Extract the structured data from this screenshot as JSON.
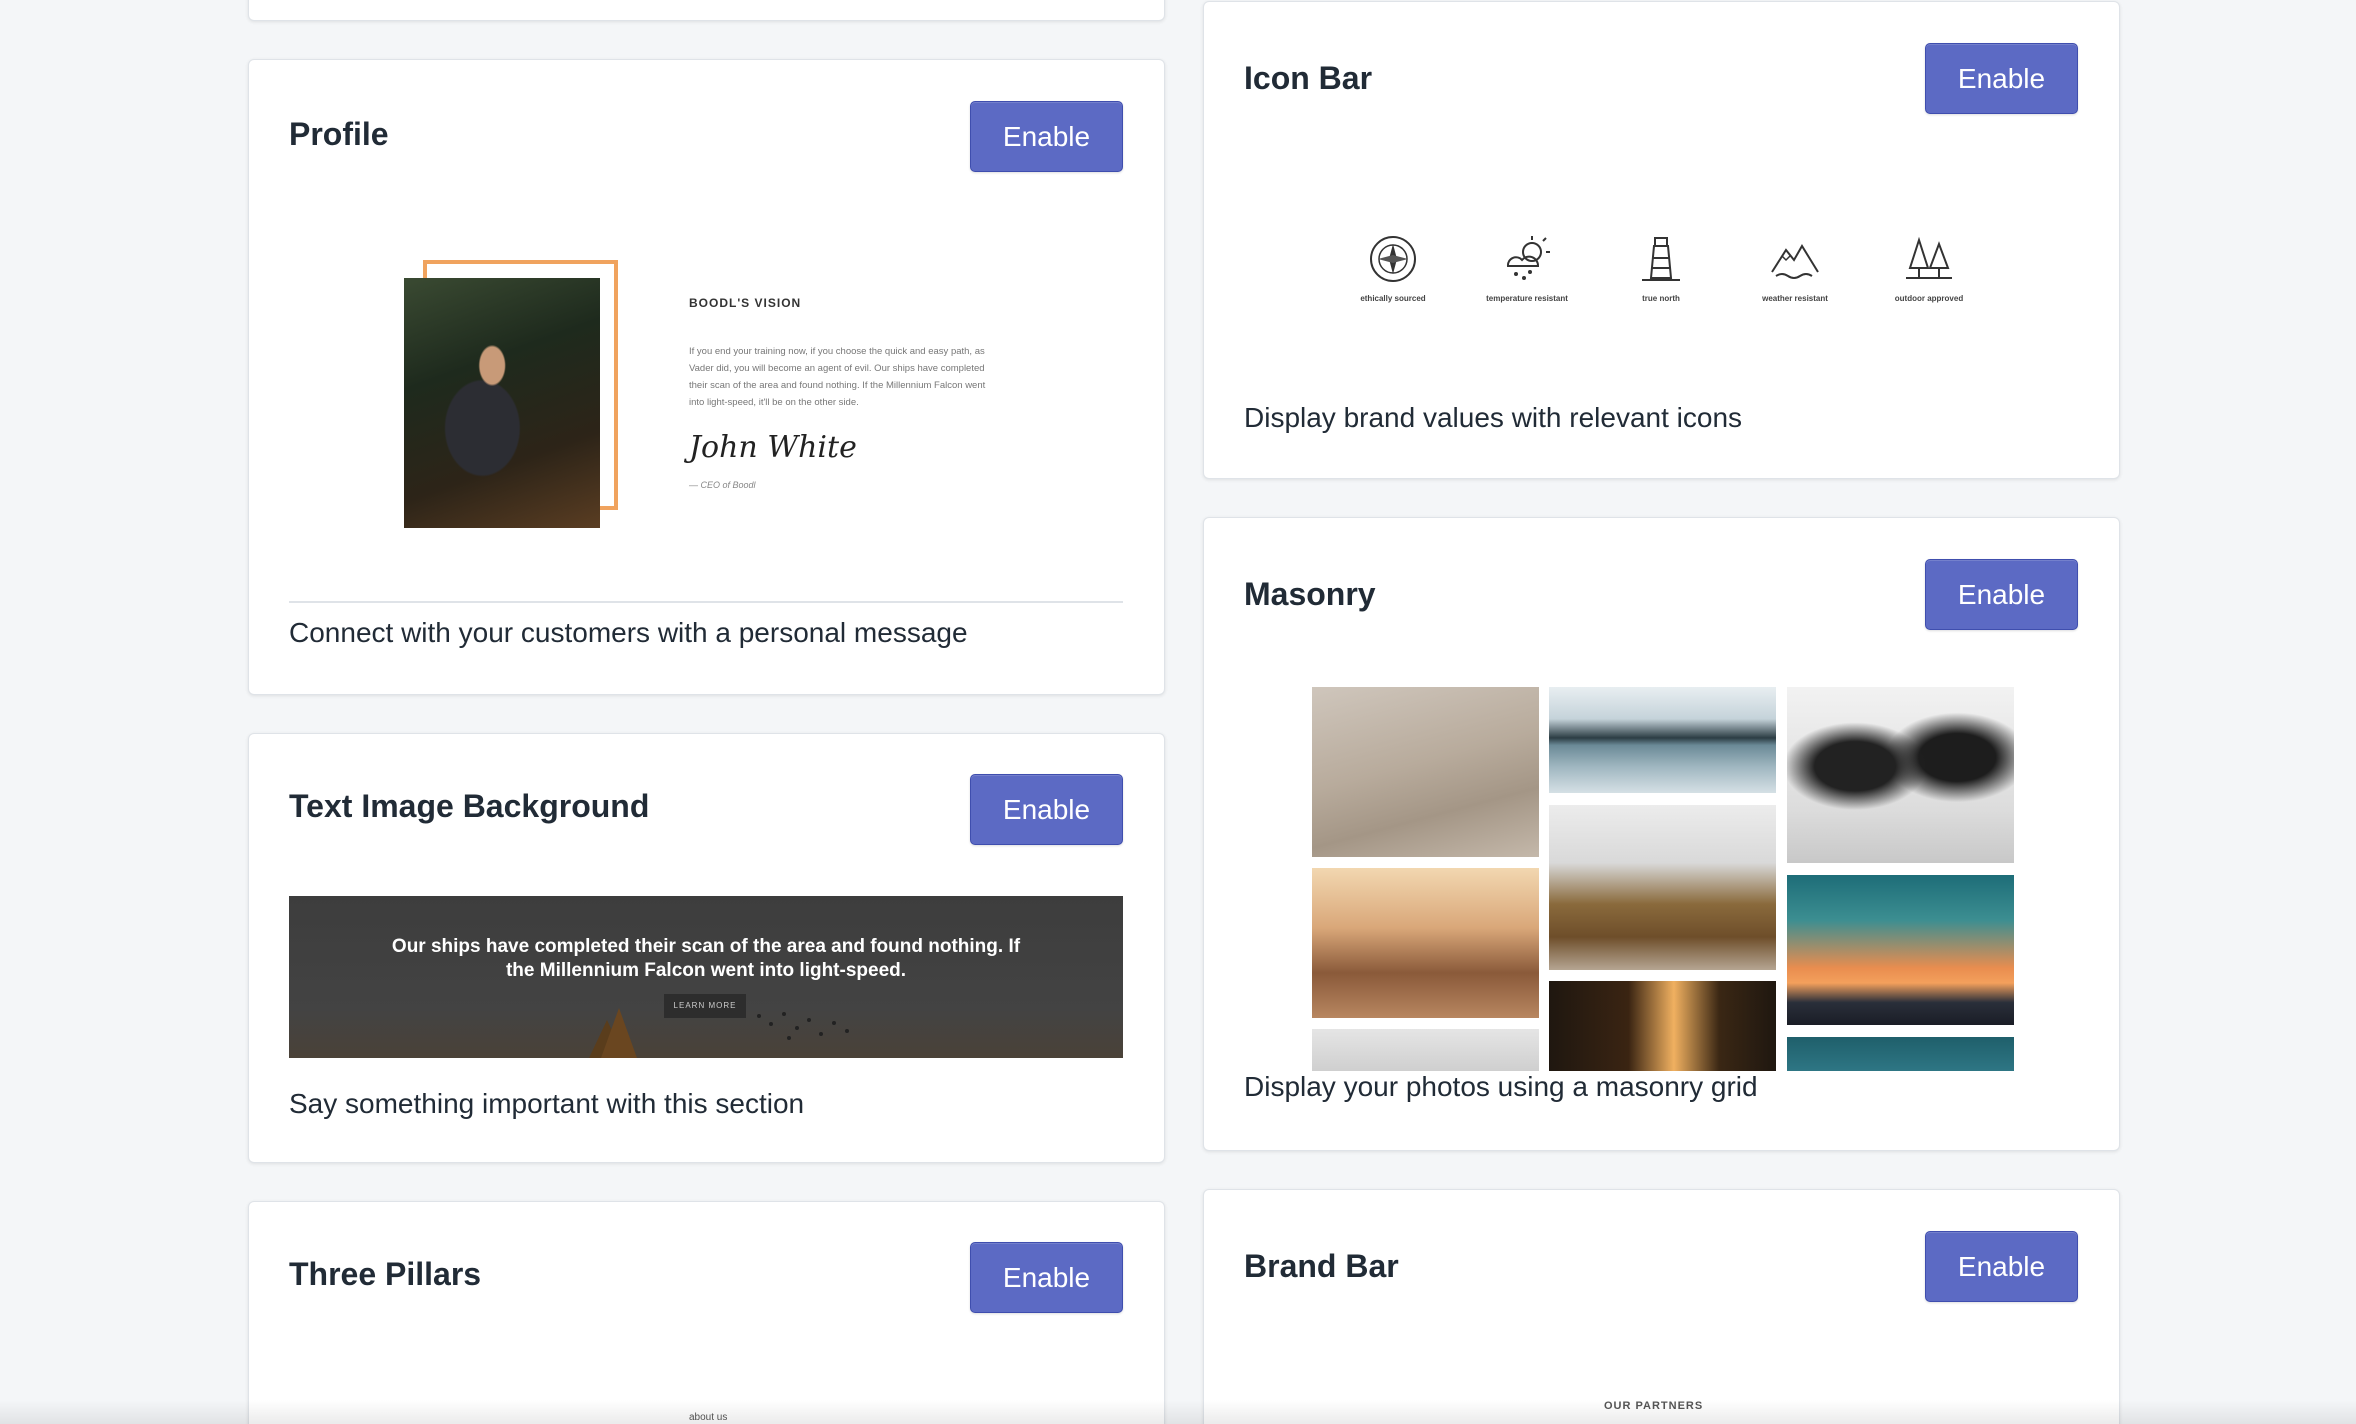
{
  "enable_label": "Enable",
  "accent_color": "#5c6ac4",
  "cards": {
    "profile": {
      "title": "Profile",
      "description": "Connect with your customers with a personal message",
      "preview": {
        "heading": "BOODL'S VISION",
        "body": "If you end your training now, if you choose the quick and easy path, as Vader did, you will become an agent of evil. Our ships have completed their scan of the area and found nothing. If the Millennium Falcon went into light-speed, it'll be on the other side.",
        "signature": "John White",
        "caption": "— CEO of Boodl"
      }
    },
    "text_image_background": {
      "title": "Text Image Background",
      "description": "Say something important with this section",
      "preview": {
        "text": "Our ships have completed their scan of the area and found nothing. If the Millennium Falcon went into light-speed.",
        "button": "LEARN MORE"
      }
    },
    "three_pillars": {
      "title": "Three Pillars",
      "preview": {
        "label": "about us"
      }
    },
    "icon_bar": {
      "title": "Icon Bar",
      "description": "Display brand values with relevant icons",
      "icons": [
        {
          "icon": "compass-icon",
          "caption": "ethically sourced"
        },
        {
          "icon": "sun-cloud-icon",
          "caption": "temperature resistant"
        },
        {
          "icon": "lighthouse-icon",
          "caption": "true north"
        },
        {
          "icon": "mountain-icon",
          "caption": "weather resistant"
        },
        {
          "icon": "trees-icon",
          "caption": "outdoor approved"
        }
      ]
    },
    "masonry": {
      "title": "Masonry",
      "description": "Display your photos using a masonry grid"
    },
    "brand_bar": {
      "title": "Brand Bar",
      "preview": {
        "label": "OUR PARTNERS"
      }
    }
  }
}
